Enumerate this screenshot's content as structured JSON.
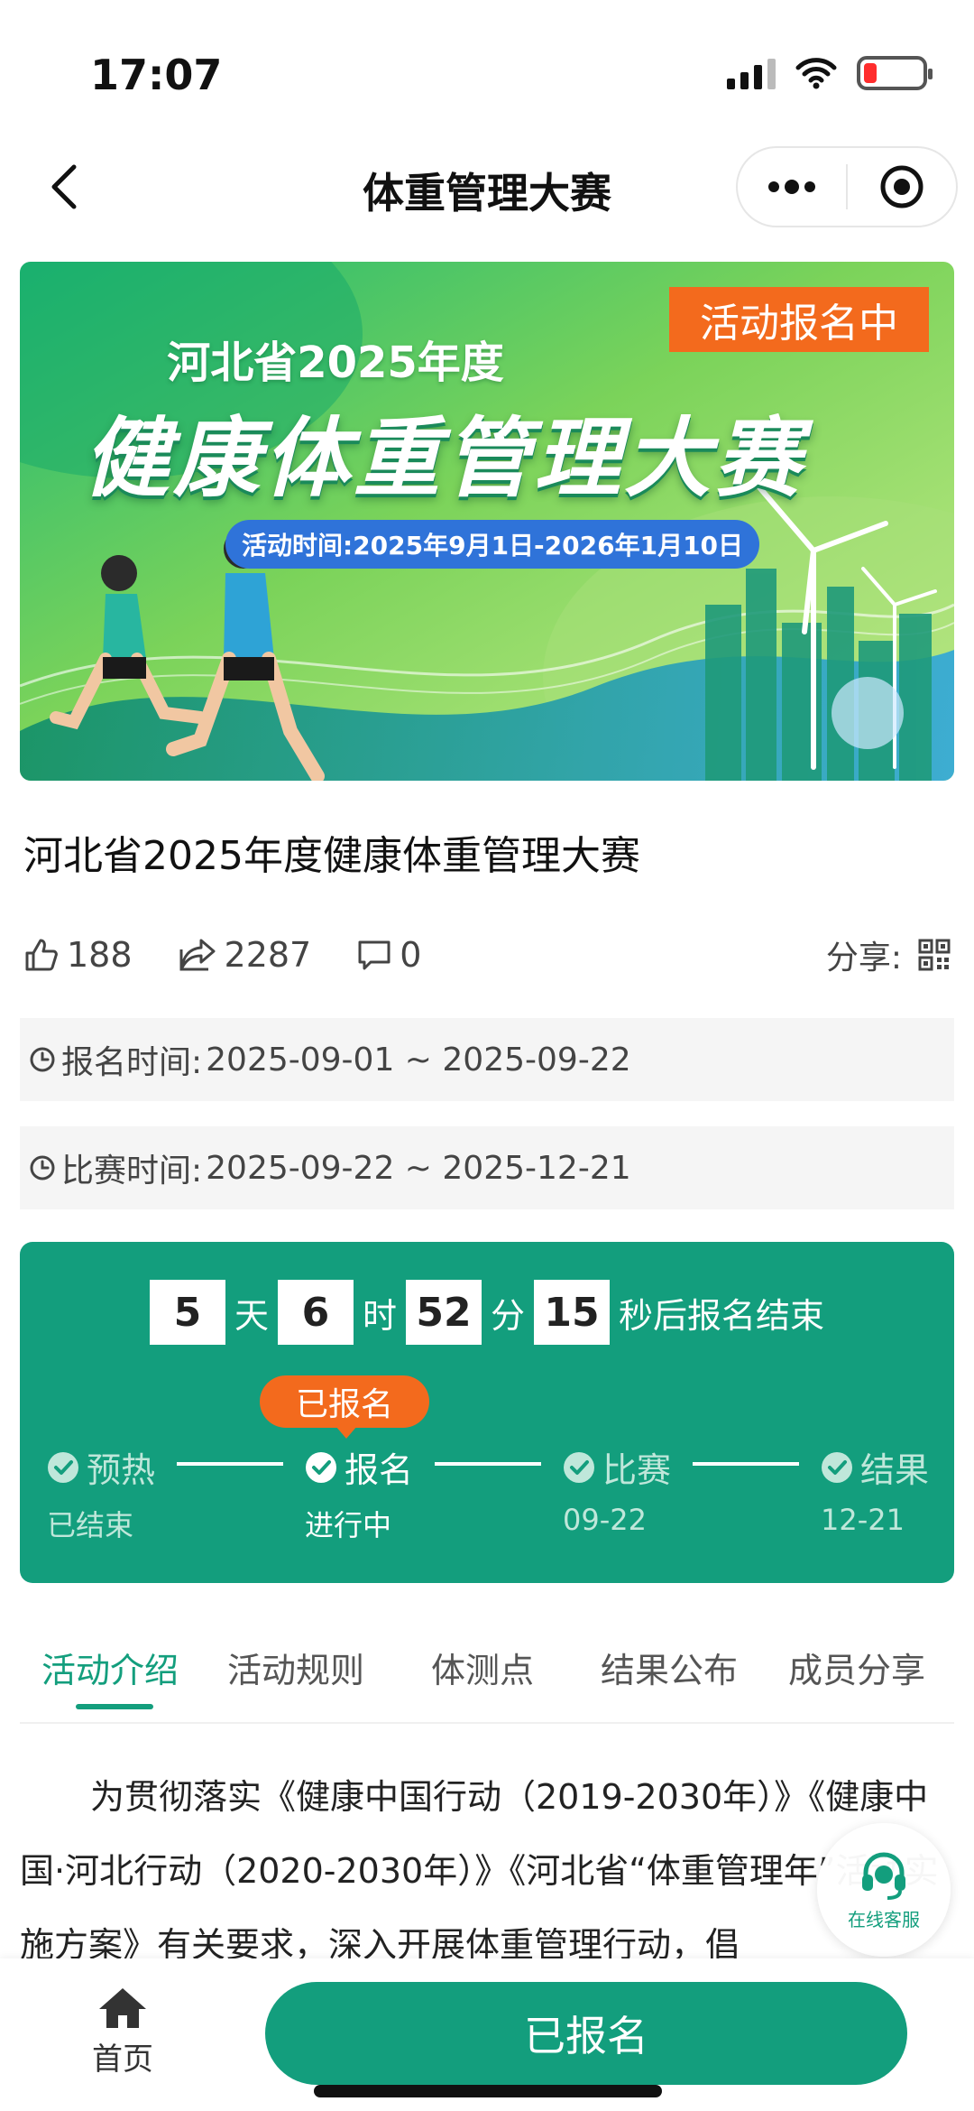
{
  "status_bar": {
    "time": "17:07",
    "battery_color": "#ff2d2d"
  },
  "nav": {
    "title": "体重管理大赛",
    "back_icon": "chevron-left-icon",
    "more_icon": "more-dots-icon",
    "close_icon": "record-target-icon"
  },
  "banner": {
    "badge": "活动报名中",
    "subtitle": "河北省2025年度",
    "title": "健康体重管理大赛",
    "date": "活动时间:2025年9月1日-2026年1月10日"
  },
  "event": {
    "title": "河北省2025年度健康体重管理大赛"
  },
  "stats": {
    "likes": "188",
    "shares": "2287",
    "comments": "0",
    "share_label": "分享:"
  },
  "times": {
    "signup_label": "报名时间:",
    "signup_value": "2025-09-01 ~ 2025-09-22",
    "match_label": "比赛时间:",
    "match_value": "2025-09-22 ~ 2025-12-21"
  },
  "countdown": {
    "days": "5",
    "days_unit": "天",
    "hours": "6",
    "hours_unit": "时",
    "minutes": "52",
    "minutes_unit": "分",
    "seconds": "15",
    "tail": "秒后报名结束"
  },
  "progress": {
    "enrolled_badge": "已报名",
    "steps": [
      {
        "name": "预热",
        "sub": "已结束"
      },
      {
        "name": "报名",
        "sub": "进行中"
      },
      {
        "name": "比赛",
        "sub": "09-22"
      },
      {
        "name": "结果",
        "sub": "12-21"
      }
    ]
  },
  "tabs": [
    "活动介绍",
    "活动规则",
    "体测点",
    "结果公布",
    "成员分享"
  ],
  "intro": {
    "text": "为贯彻落实《健康中国行动（2019-2030年）》《健康中国·河北行动（2020-2030年）》《河北省“体重管理年”活动实施方案》有关要求，深入开展体重管理行动，倡"
  },
  "service": {
    "label": "在线客服"
  },
  "bottom": {
    "home_label": "首页",
    "enroll_button": "已报名"
  },
  "colors": {
    "primary": "#139e7d",
    "orange": "#f36a1d",
    "date_pill": "#2f73d9"
  }
}
